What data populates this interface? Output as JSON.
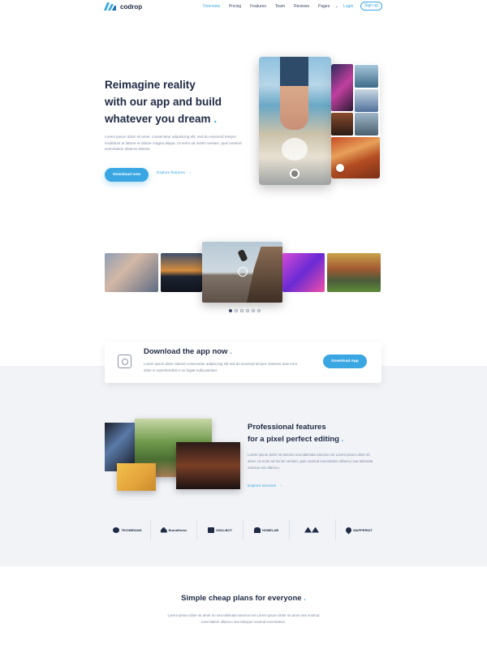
{
  "brand": {
    "name": "codrop"
  },
  "nav": {
    "items": [
      "Overview",
      "Pricing",
      "Features",
      "Team",
      "Reviews",
      "Pages"
    ],
    "pages_caret": "⌄",
    "login": "Login",
    "signup": "Sign up"
  },
  "hero": {
    "title_line1": "Reimagine reality",
    "title_line2": "with our app and build",
    "title_line3": "whatever you dream",
    "title_dot": ".",
    "description": "Lorem ipsum dolor sit amet, consectetur adipisicing elit, sed do eiusmod tempor incididunt ut labore et dolore magna aliqua. Ut enim ad minim veniam, quis nostrud exercitation ullamco laboris.",
    "cta": "Download now",
    "explore": "Explore features",
    "explore_arrow": "›"
  },
  "carousel": {
    "slide_count": 6,
    "active_index": 0
  },
  "download": {
    "title": "Download the app now",
    "title_dot": ".",
    "description": "Lorem ipsum dolor sitamet consectetur adipisicing elit sed do eiusmod tempor. Duisens aute irure dolor in reprehenderit e eu fugiat nulla pariatur.",
    "button": "Download App"
  },
  "features": {
    "title_line1": "Professional features",
    "title_line2": "for a pixel perfect editing",
    "title_dot": ".",
    "description": "Lorem ipsum dolor sit ametno sea takimata sanctus est Lorem ipsum dolor sit amet. Ut enim ad minim veniam, quis nostrud exercitation ullamco sea takimata sanctus est ullamco.",
    "link": "Explore services",
    "link_arrow": "›"
  },
  "brands": [
    "TECHBRAND",
    "BrandHome",
    "OWLLBOT",
    "HOMELAB",
    "",
    "MAPPERKIT"
  ],
  "plans": {
    "title": "Simple cheap plans for everyone",
    "title_dot": ".",
    "description": "Lorem ipsum dolor sit amet no sea takimata sanctus est Lorem ipsum dolor sit amet sea nostrud exercitation ullamco sea takayus nostrud exercitation."
  },
  "colors": {
    "accent": "#3aa7e3",
    "heading": "#1f2a44",
    "body": "#7f8aa3",
    "band": "#f1f3f7"
  }
}
